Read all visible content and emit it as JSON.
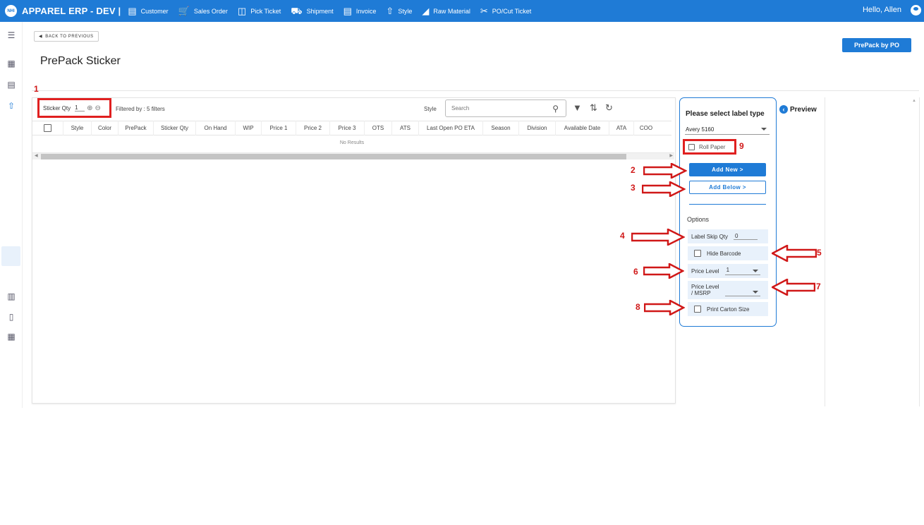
{
  "header": {
    "logo_text": "NHI",
    "app_title": "APPAREL ERP  -  DEV  |",
    "greeting": "Hello, Allen",
    "nav": [
      {
        "label": "Customer",
        "icon": "storefront-icon"
      },
      {
        "label": "Sales Order",
        "icon": "cart-icon"
      },
      {
        "label": "Pick Ticket",
        "icon": "clipboard-icon"
      },
      {
        "label": "Shipment",
        "icon": "truck-icon"
      },
      {
        "label": "Invoice",
        "icon": "invoice-icon"
      },
      {
        "label": "Style",
        "icon": "shirt-icon"
      },
      {
        "label": "Raw Material",
        "icon": "material-icon"
      },
      {
        "label": "PO/Cut Ticket",
        "icon": "scissors-icon"
      }
    ]
  },
  "page": {
    "back_label": "BACK TO PREVIOUS",
    "title": "PrePack Sticker",
    "prepack_po_label": "PrePack by PO"
  },
  "grid": {
    "sticker_qty_label": "Sticker Qty",
    "sticker_qty_value": "1",
    "filtered_text": "Filtered by :  5 filters",
    "style_label": "Style",
    "search_placeholder": "Search",
    "columns": [
      "Style",
      "Color",
      "PrePack",
      "Sticker Qty",
      "On Hand",
      "WIP",
      "Price 1",
      "Price 2",
      "Price 3",
      "OTS",
      "ATS",
      "Last Open PO ETA",
      "Season",
      "Division",
      "Available Date",
      "ATA",
      "COO"
    ],
    "empty_text": "No Results"
  },
  "label_panel": {
    "title": "Please select label type",
    "label_type": "Avery 5160",
    "roll_paper_label": "Roll Paper",
    "add_new_label": "Add New >",
    "add_below_label": "Add Below >",
    "options_label": "Options",
    "label_skip_qty_label": "Label Skip Qty",
    "label_skip_qty_value": "0",
    "hide_barcode_label": "Hide Barcode",
    "price_level_label": "Price Level",
    "price_level_value": "1",
    "price_level_msrp_label_1": "Price Level",
    "price_level_msrp_label_2": "/ MSRP",
    "price_level_msrp_value": "",
    "print_carton_size_label": "Print Carton Size"
  },
  "preview": {
    "label": "Preview"
  },
  "annotations": [
    "1",
    "2",
    "3",
    "4",
    "5",
    "6",
    "7",
    "8",
    "9"
  ],
  "colors": {
    "primary": "#1f7bd6",
    "annotation": "#d01818",
    "option_bg": "#e8f1fb"
  }
}
